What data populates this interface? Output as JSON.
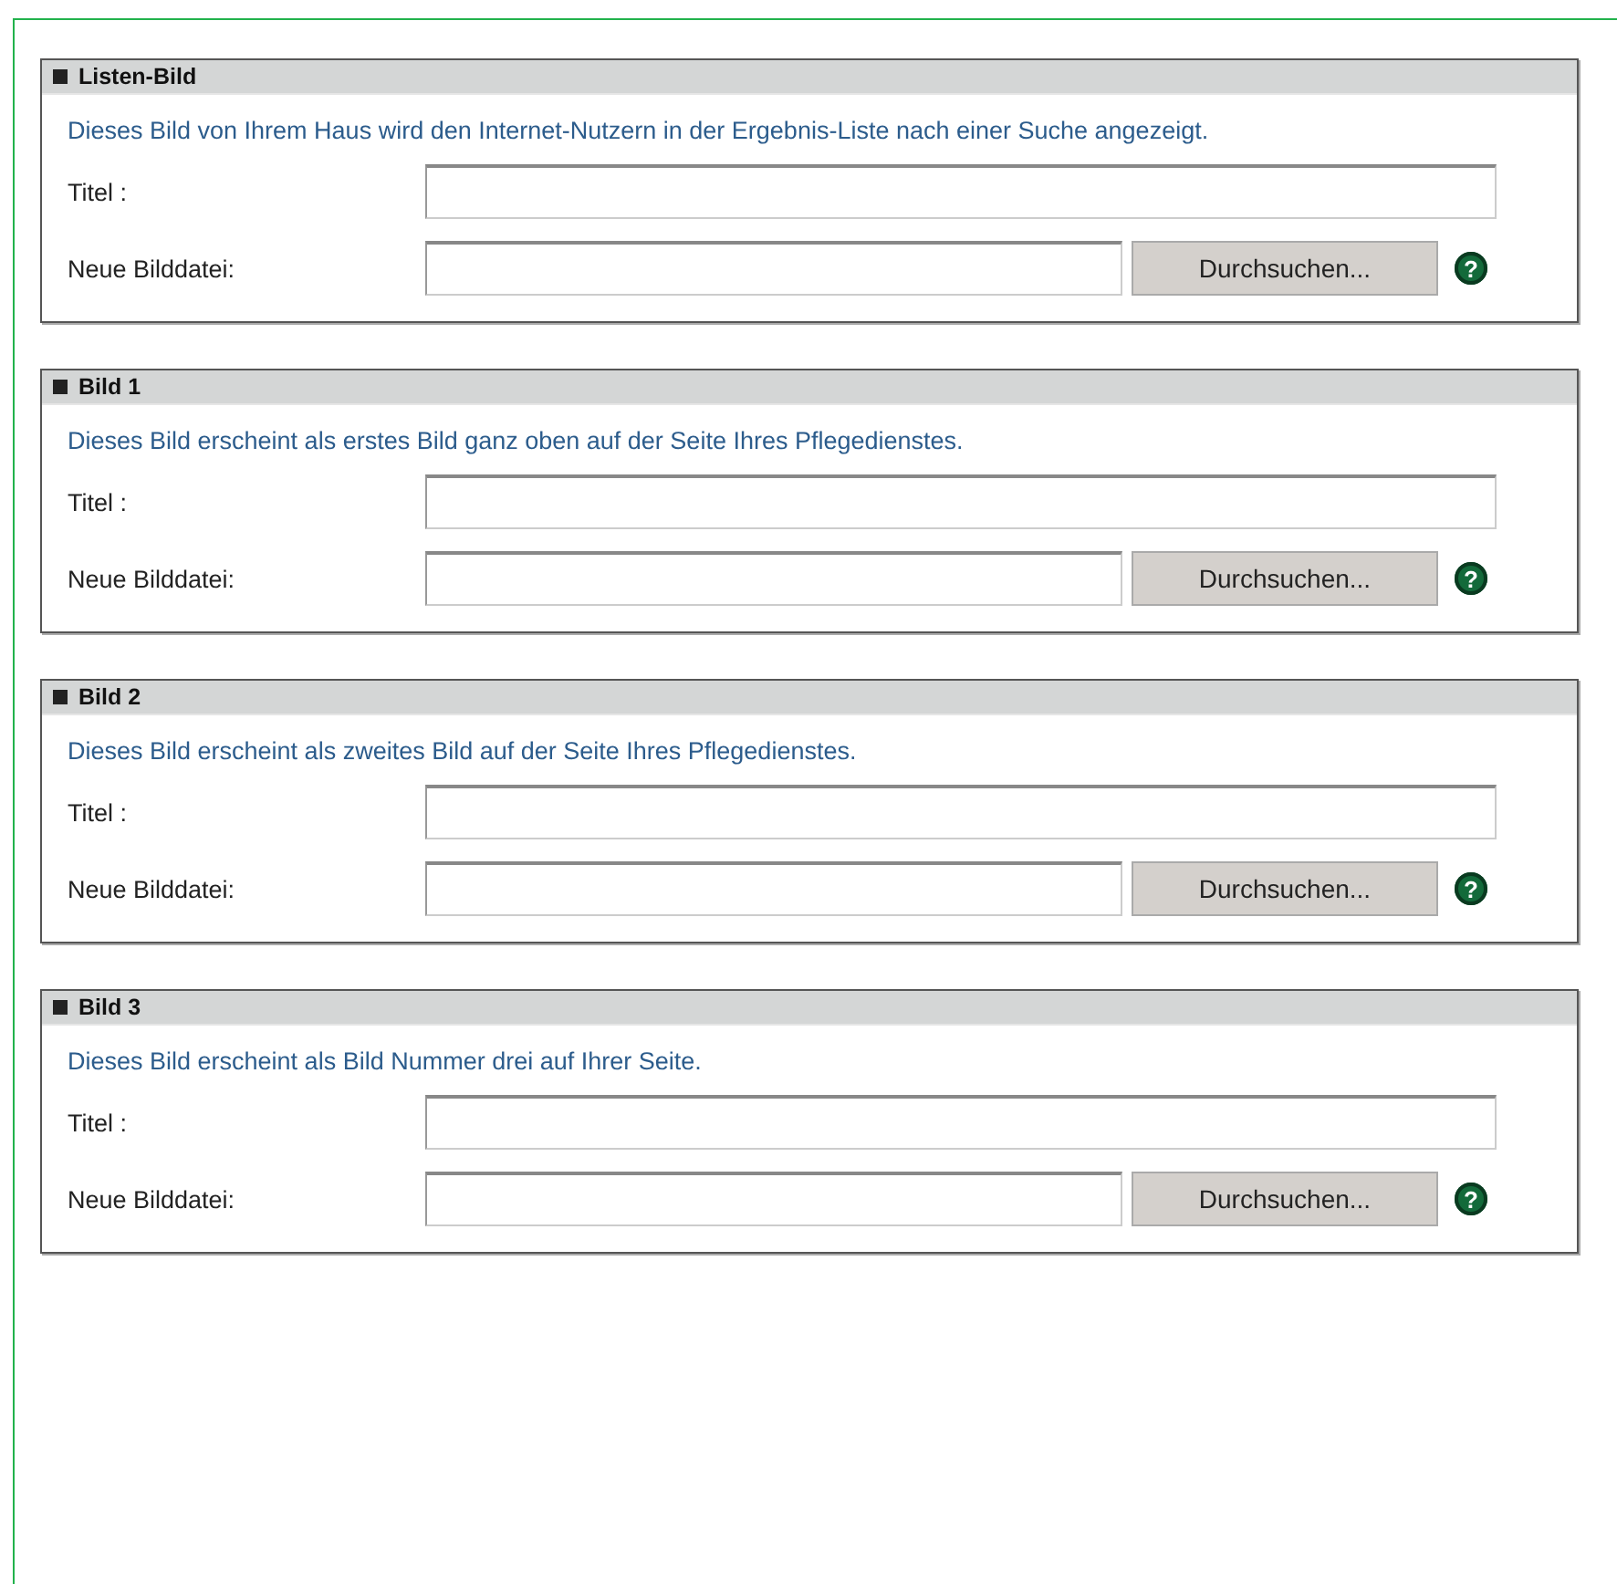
{
  "sections": [
    {
      "title": "Listen-Bild",
      "description": "Dieses Bild von Ihrem Haus wird den Internet-Nutzern in der Ergebnis-Liste nach einer Suche angezeigt.",
      "title_label": "Titel :",
      "file_label": "Neue Bilddatei:",
      "browse_button": "Durchsuchen...",
      "help_icon": "?"
    },
    {
      "title": "Bild 1",
      "description": "Dieses Bild erscheint als erstes Bild ganz oben auf der Seite Ihres Pflegedienstes.",
      "title_label": "Titel :",
      "file_label": "Neue Bilddatei:",
      "browse_button": "Durchsuchen...",
      "help_icon": "?"
    },
    {
      "title": "Bild 2",
      "description": "Dieses Bild erscheint als zweites Bild auf der Seite Ihres Pflegedienstes.",
      "title_label": "Titel :",
      "file_label": "Neue Bilddatei:",
      "browse_button": "Durchsuchen...",
      "help_icon": "?"
    },
    {
      "title": "Bild 3",
      "description": "Dieses Bild erscheint als Bild Nummer drei auf Ihrer Seite.",
      "title_label": "Titel :",
      "file_label": "Neue Bilddatei:",
      "browse_button": "Durchsuchen...",
      "help_icon": "?"
    }
  ]
}
